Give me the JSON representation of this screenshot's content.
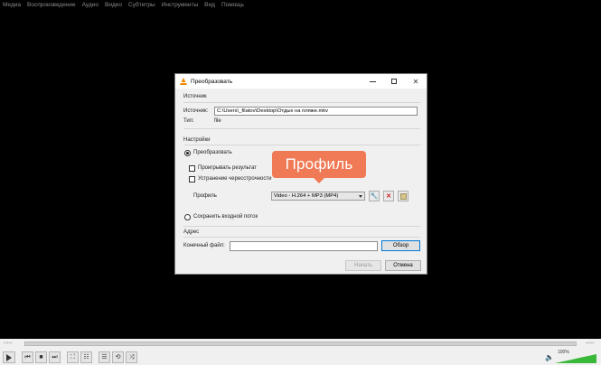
{
  "menu": [
    "Медиа",
    "Воспроизведение",
    "Аудио",
    "Видео",
    "Субтитры",
    "Инструменты",
    "Вид",
    "Помощь"
  ],
  "dialog": {
    "title": "Преобразовать",
    "source_section": "Источник",
    "source_label": "Источник:",
    "source_value": "C:\\Users\\_filatov\\Desktop\\Отдых на пляже.mkv",
    "type_label": "Тип:",
    "type_value": "file",
    "settings_section": "Настройки",
    "convert_label": "Преобразовать",
    "play_result_label": "Проигрывать результат",
    "deinterlace_label": "Устранение чересстрочности",
    "profile_label": "Профиль",
    "profile_value": "Video - H.264 + MP3 (MP4)",
    "save_raw_label": "Сохранить входной поток",
    "address_section": "Адрес",
    "dest_label": "Конечный файл:",
    "dest_value": "",
    "browse_button": "Обзор",
    "start_button": "Начать",
    "cancel_button": "Отмена"
  },
  "callout": "Профиль",
  "player": {
    "time_left": "--:--",
    "time_right": "--:--",
    "volume": "100%",
    "accent_color": "#3ab83a"
  }
}
